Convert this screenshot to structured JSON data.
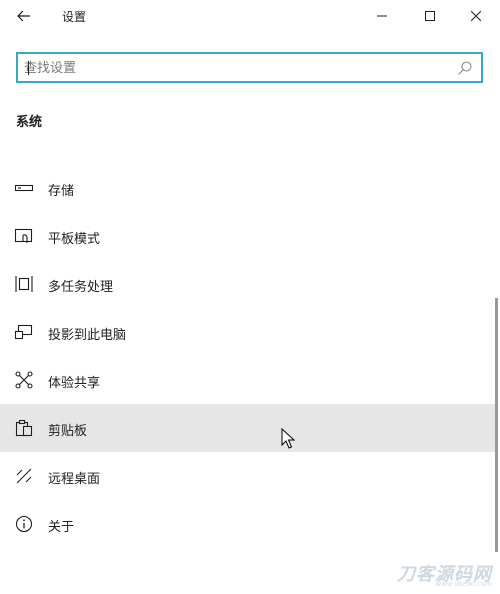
{
  "window": {
    "title": "设置",
    "back_icon": "arrow-left-icon",
    "minimize_icon": "minimize-icon",
    "maximize_icon": "maximize-icon",
    "close_icon": "close-icon"
  },
  "search": {
    "placeholder": "查找设置",
    "value": "",
    "icon": "search-icon",
    "focus_color": "#3aa7c9"
  },
  "section": {
    "title": "系统"
  },
  "nav": {
    "items": [
      {
        "label": "存储",
        "icon": "storage-icon"
      },
      {
        "label": "平板模式",
        "icon": "tablet-mode-icon"
      },
      {
        "label": "多任务处理",
        "icon": "multitasking-icon"
      },
      {
        "label": "投影到此电脑",
        "icon": "projecting-icon"
      },
      {
        "label": "体验共享",
        "icon": "shared-experiences-icon"
      },
      {
        "label": "剪贴板",
        "icon": "clipboard-icon"
      },
      {
        "label": "远程桌面",
        "icon": "remote-desktop-icon"
      },
      {
        "label": "关于",
        "icon": "info-icon"
      }
    ],
    "hovered_index": 5,
    "hover_color": "#e6e6e6"
  },
  "watermark": {
    "text": "刀客源码网",
    "subtext": "www.dkewl.com"
  }
}
